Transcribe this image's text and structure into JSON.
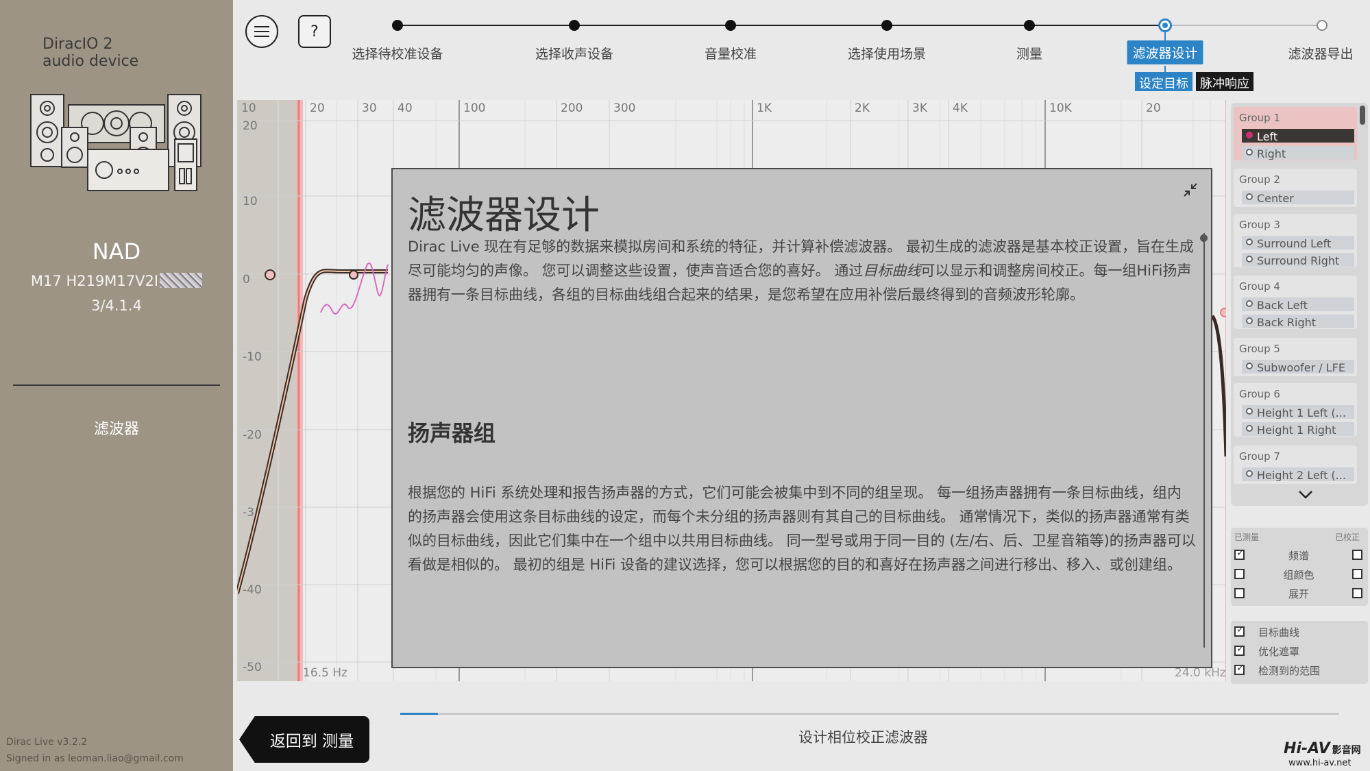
{
  "sidebar": {
    "device_line1": "DiracIO 2",
    "device_line2": "audio device",
    "brand": "NAD",
    "model": "M17 H219M17V2I",
    "firmware": "3/4.1.4",
    "section": "滤波器",
    "version": "Dirac Live v3.2.2",
    "signed_in": "Signed in as leoman.liao@gmail.com"
  },
  "toolbar": {
    "help_label": "?"
  },
  "steps": [
    {
      "label": "选择待校准设备",
      "state": "done"
    },
    {
      "label": "选择收声设备",
      "state": "done"
    },
    {
      "label": "音量校准",
      "state": "done"
    },
    {
      "label": "选择使用场景",
      "state": "done"
    },
    {
      "label": "测量",
      "state": "done"
    },
    {
      "label": "滤波器设计",
      "state": "active"
    },
    {
      "label": "滤波器导出",
      "state": "future"
    }
  ],
  "sub_tabs": {
    "target": "设定目标",
    "impulse": "脉冲响应"
  },
  "chart_data": {
    "type": "line",
    "x_scale": "log",
    "x_tick_labels": [
      "10",
      "20",
      "30",
      "40",
      "100",
      "200",
      "300",
      "1K",
      "2K",
      "3K",
      "4K",
      "10K",
      "20"
    ],
    "y_tick_labels": [
      "20",
      "10",
      "0",
      "-10",
      "-20",
      "-3",
      "-40",
      "-50"
    ],
    "ylim": [
      -50,
      20
    ],
    "left_limit_label": "16.5 Hz",
    "right_limit_label": "24.0 kHz",
    "grid": true
  },
  "groups": [
    {
      "title": "Group 1",
      "channels": [
        "Left",
        "Right"
      ],
      "selected": true,
      "selected_channel": 0
    },
    {
      "title": "Group 2",
      "channels": [
        "Center"
      ]
    },
    {
      "title": "Group 3",
      "channels": [
        "Surround Left",
        "Surround Right"
      ]
    },
    {
      "title": "Group 4",
      "channels": [
        "Back Left",
        "Back Right"
      ]
    },
    {
      "title": "Group 5",
      "channels": [
        "Subwoofer / LFE"
      ]
    },
    {
      "title": "Group 6",
      "channels": [
        "Height 1 Left (...",
        "Height 1 Right"
      ]
    },
    {
      "title": "Group 7",
      "channels": [
        "Height 2 Left (..."
      ]
    }
  ],
  "options": {
    "measured_label": "已测量",
    "calibrated_label": "已校正",
    "rows": [
      {
        "label": "频谱",
        "measured": true,
        "calibrated": false
      },
      {
        "label": "组颜色",
        "measured": false,
        "calibrated": false
      },
      {
        "label": "展开",
        "measured": false,
        "calibrated": false
      }
    ]
  },
  "display": [
    {
      "label": "目标曲线",
      "checked": true
    },
    {
      "label": "优化遮罩",
      "checked": true
    },
    {
      "label": "检测到的范围",
      "checked": true
    }
  ],
  "modal": {
    "title": "滤波器设计",
    "para1_a": "Dirac Live 现在有足够的数据来模拟房间和系统的特征，并计算补偿滤波器。 最初生成的滤波器是基本校正设置，旨在生成尽可能均匀的声像。 您可以调整这些设置，使声音适合您的喜好。 通过",
    "para1_em": "目标曲线",
    "para1_b": "可以显示和调整房间校正。每一组HiFi扬声器拥有一条目标曲线，各组的目标曲线组合起来的结果，是您希望在应用补偿后最终得到的音频波形轮廓。",
    "subtitle": "扬声器组",
    "para2": "根据您的 HiFi 系统处理和报告扬声器的方式，它们可能会被集中到不同的组呈现。 每一组扬声器拥有一条目标曲线，组内的扬声器会使用这条目标曲线的设定，而每个未分组的扬声器则有其自己的目标曲线。 通常情况下，类似的扬声器通常有类似的目标曲线，因此它们集中在一个组中以共用目标曲线。 同一型号或用于同一目的 (左/右、后、卫星音箱等)的扬声器可以看做是相似的。 最初的组是 HiFi 设备的建议选择，您可以根据您的目的和喜好在扬声器之间进行移出、移入、或创建组。"
  },
  "bottom": {
    "back_label": "返回到 测量",
    "progress": 0.04,
    "progress_label": "设计相位校正滤波器"
  },
  "watermark": {
    "brand": "Hi-AV",
    "brand_cn": "影音网",
    "url": "www.hi-av.net"
  },
  "colors": {
    "accent": "#2c84c6",
    "sidebar": "#9d9485",
    "curve_measured": "#d66bc0",
    "target": "#3a2a26",
    "mask": "#e08080"
  }
}
